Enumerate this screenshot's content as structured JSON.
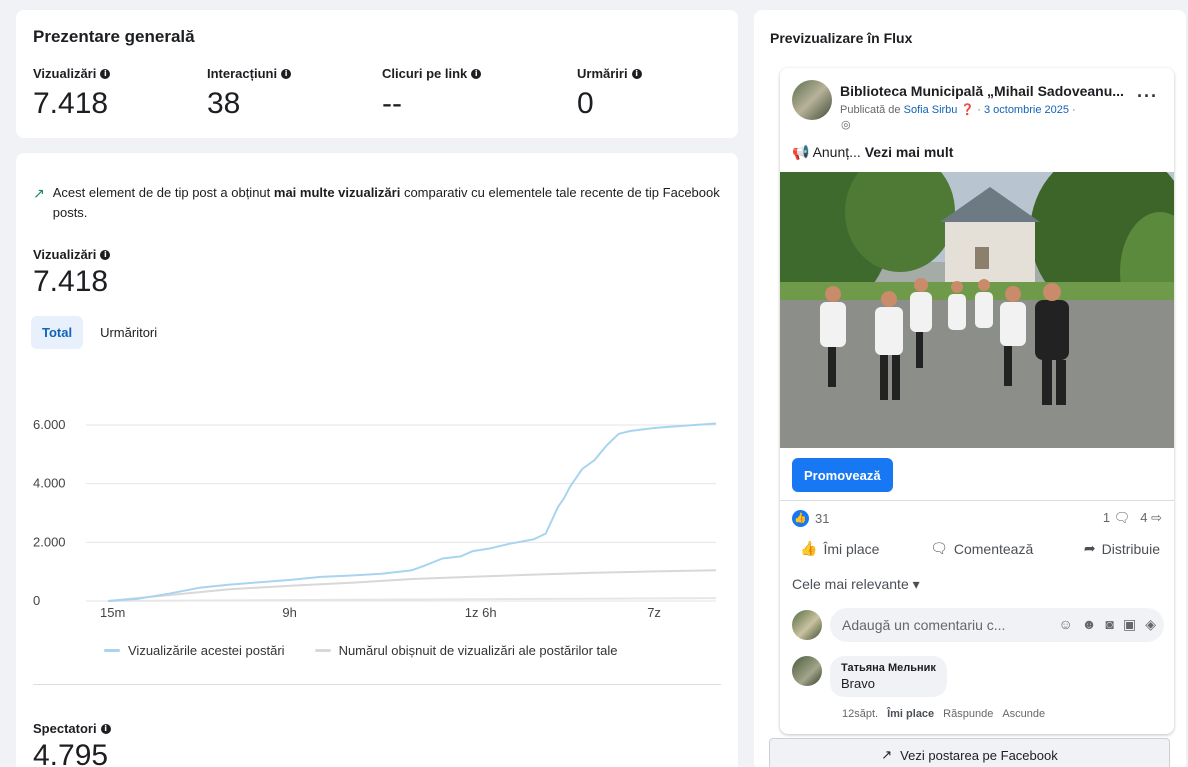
{
  "overview": {
    "title": "Prezentare generală",
    "metrics": [
      {
        "label": "Vizualizări",
        "value": "7.418"
      },
      {
        "label": "Interacțiuni",
        "value": "38"
      },
      {
        "label": "Clicuri pe link",
        "value": "--"
      },
      {
        "label": "Urmăriri",
        "value": "0"
      }
    ]
  },
  "insight": {
    "pre": "Acest element de de tip post a obținut",
    "bold": "mai multe vizualizări",
    "post": "comparativ cu elementele tale recente de tip Facebook posts."
  },
  "views_section": {
    "label": "Vizualizări",
    "value": "7.418"
  },
  "tabs": [
    "Total",
    "Urmăritori"
  ],
  "chart_data": {
    "type": "line",
    "x_ticks": [
      "15m",
      "9h",
      "1z 6h",
      "7z"
    ],
    "y_ticks": [
      "0",
      "2.000",
      "4.000",
      "6.000"
    ],
    "ylim": [
      0,
      6000
    ],
    "grid": true,
    "legend_position": "bottom",
    "series": [
      {
        "name": "Vizualizările acestei postări",
        "color": "#a8d4f0",
        "x": [
          0,
          0.05,
          0.1,
          0.15,
          0.2,
          0.25,
          0.3,
          0.35,
          0.4,
          0.45,
          0.5,
          0.52,
          0.55,
          0.58,
          0.6,
          0.63,
          0.66,
          0.7,
          0.72,
          0.74,
          0.75,
          0.76,
          0.77,
          0.78,
          0.8,
          0.82,
          0.84,
          0.86,
          0.88,
          0.9,
          0.95,
          1.0
        ],
        "values": [
          0,
          80,
          250,
          450,
          560,
          640,
          720,
          820,
          870,
          930,
          1050,
          1200,
          1450,
          1520,
          1700,
          1800,
          1950,
          2100,
          2300,
          3200,
          3500,
          3900,
          4200,
          4500,
          4800,
          5300,
          5700,
          5800,
          5850,
          5900,
          5980,
          6050
        ]
      },
      {
        "name": "Numărul obișnuit de vizualizări ale postărilor tale",
        "color": "#d8d8d8",
        "x": [
          0,
          0.1,
          0.2,
          0.3,
          0.4,
          0.5,
          0.6,
          0.7,
          0.8,
          0.9,
          1.0
        ],
        "values": [
          0,
          200,
          400,
          520,
          620,
          750,
          830,
          900,
          960,
          1010,
          1050
        ]
      },
      {
        "name": "",
        "color": "#e6e6e6",
        "x": [
          0,
          0.2,
          0.4,
          0.6,
          0.8,
          1.0
        ],
        "values": [
          0,
          20,
          40,
          60,
          80,
          100
        ]
      }
    ]
  },
  "spectators": {
    "label": "Spectatori",
    "value": "4.795"
  },
  "preview": {
    "title": "Previzualizare în Flux",
    "page_name": "Biblioteca Municipală „Mihail Sadoveanu...",
    "published_by_prefix": "Publicată de",
    "published_by_name": "Sofia Sirbu",
    "date": "3 octombrie 2025",
    "post_text": "Anunț...",
    "see_more": "Vezi mai mult",
    "promote_button": "Promovează",
    "reaction_count": "31",
    "comment_count": "1",
    "share_count": "4",
    "actions": [
      "Îmi place",
      "Comentează",
      "Distribuie"
    ],
    "relevance_filter": "Cele mai relevante",
    "comment_placeholder": "Adaugă un comentariu c...",
    "comment": {
      "author": "Татьяна Мельник",
      "text": "Bravo",
      "time": "12săpt.",
      "like": "Îmi place",
      "reply": "Răspunde",
      "hide": "Ascunde"
    },
    "view_on_facebook": "Vezi postarea pe Facebook"
  }
}
